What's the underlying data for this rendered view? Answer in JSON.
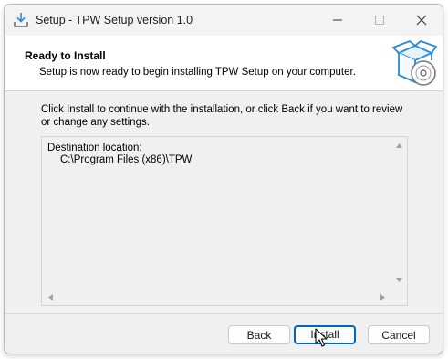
{
  "window": {
    "title": "Setup - TPW Setup version 1.0",
    "controls": {
      "minimize_icon": "minimize-icon",
      "maximize_icon": "maximize-icon",
      "close_icon": "close-icon"
    }
  },
  "header": {
    "title": "Ready to Install",
    "subtitle": "Setup is now ready to begin installing TPW Setup on your computer.",
    "image_icon": "setup-box-disc-icon"
  },
  "body": {
    "intro": "Click Install to continue with the installation, or click Back if you want to review or change any settings.",
    "memo": {
      "label": "Destination location:",
      "value": "C:\\Program Files (x86)\\TPW"
    }
  },
  "buttons": {
    "back": "Back",
    "install": "Install",
    "cancel": "Cancel"
  },
  "colors": {
    "accent": "#0067c0",
    "icon_blue": "#2b8ad6"
  }
}
